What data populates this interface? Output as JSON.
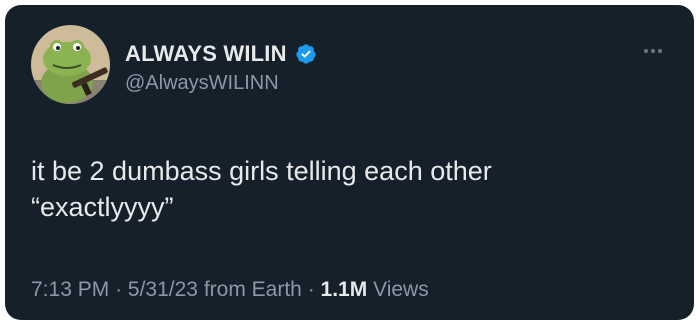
{
  "tweet": {
    "author": {
      "display_name": "ALWAYS WILIN",
      "handle": "@AlwaysWILINN",
      "verified": true,
      "avatar_icon": "frog-avatar"
    },
    "text": "it be 2 dumbass girls telling each other\n“exactlyyyy”",
    "time": "7:13 PM",
    "date": "5/31/23",
    "source": "from Earth",
    "separator": "·",
    "views_count": "1.1M",
    "views_label": "Views",
    "more_icon": "more-horizontal-icon"
  },
  "colors": {
    "background": "#15202b",
    "text_primary": "#e7e9ea",
    "text_secondary": "#8b98a5",
    "verified_badge": "#1d9bf0"
  }
}
